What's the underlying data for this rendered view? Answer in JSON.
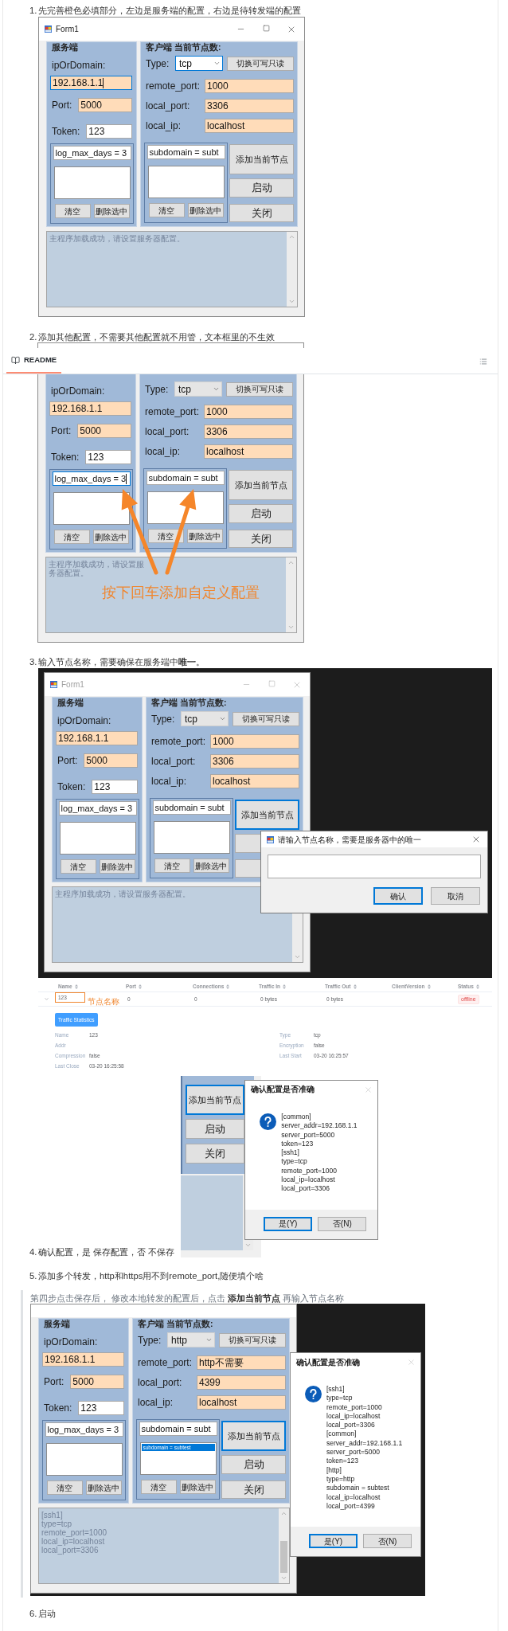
{
  "readme_tab": {
    "label": "README",
    "selected": true
  },
  "steps": [
    {
      "number": "1.",
      "text": "先完善橙色必填部分，左边是服务端的配置，右边是待转发端的配置",
      "figures": [
        {
          "kind": "form",
          "form": {
            "title_bar": {
              "title": "Form1",
              "active": true
            },
            "server": {
              "title": "服务端",
              "fields": [
                {
                  "kind": "stacked",
                  "label": "ipOrDomain:",
                  "value": "192.168.1.1",
                  "required": true,
                  "focused": true
                },
                {
                  "kind": "inline",
                  "label": "Port:",
                  "value": "5000",
                  "required": true,
                  "focused": false
                },
                {
                  "kind": "inline",
                  "label": "Token:",
                  "value": "123",
                  "required": false,
                  "focused": false
                }
              ],
              "param_input": {
                "value": "log_max_days = 3",
                "focused": false
              },
              "buttons": [
                "清空",
                "删除选中"
              ]
            },
            "client": {
              "title": "客户端 当前节点数:",
              "type": {
                "label": "Type:",
                "value": "tcp",
                "focused": true
              },
              "toggle_button": "切换可写只读",
              "fields": [
                {
                  "label": "remote_port:",
                  "value": "1000",
                  "required": true,
                  "focused": false
                },
                {
                  "label": "local_port:",
                  "value": "3306",
                  "required": true,
                  "focused": false
                },
                {
                  "label": "local_ip:",
                  "value": "localhost",
                  "required": true,
                  "focused": false
                }
              ],
              "param_input": {
                "value": "subdomain = subt",
                "focused": false
              },
              "buttons": [
                "清空",
                "删除选中"
              ]
            },
            "action_buttons": [
              {
                "label": "添加当前节点",
                "focused": false
              },
              {
                "label": "启动",
                "focused": false
              },
              {
                "label": "关闭",
                "focused": false
              }
            ],
            "log": {
              "lines": [
                "主程序加载成功，请设置服务器配置。"
              ],
              "scrollbar_thumb": false
            }
          }
        }
      ]
    },
    {
      "number": "2.",
      "text": "添加其他配置，不需要其他配置就不用管，文本框里的不生效",
      "figures": [
        {
          "kind": "annotated_form",
          "caption": "按下回车添加自定义配置",
          "form": {
            "server": {
              "fields": [
                {
                  "kind": "stacked",
                  "label": "ipOrDomain:",
                  "value": "192.168.1.1",
                  "required": true,
                  "focused": false
                },
                {
                  "kind": "inline",
                  "label": "Port:",
                  "value": "5000",
                  "required": true,
                  "focused": false
                },
                {
                  "kind": "inline",
                  "label": "Token:",
                  "value": "123",
                  "required": false,
                  "focused": false
                }
              ],
              "param_input": {
                "value": "log_max_days = 3",
                "focused": true
              },
              "buttons": [
                "清空",
                "删除选中"
              ]
            },
            "client": {
              "type": {
                "label": "Type:",
                "value": "tcp",
                "focused": false
              },
              "toggle_button": "切换可写只读",
              "fields": [
                {
                  "label": "remote_port:",
                  "value": "1000",
                  "required": true,
                  "focused": false
                },
                {
                  "label": "local_port:",
                  "value": "3306",
                  "required": true,
                  "focused": false
                },
                {
                  "label": "local_ip:",
                  "value": "localhost",
                  "required": true,
                  "focused": false
                }
              ],
              "param_input": {
                "value": "subdomain = subt",
                "focused": false
              },
              "buttons": [
                "清空",
                "删除选中"
              ]
            },
            "action_buttons": [
              {
                "label": "添加当前节点",
                "focused": false
              },
              {
                "label": "启动",
                "focused": false
              },
              {
                "label": "关闭",
                "focused": false
              }
            ],
            "log": {
              "lines": [
                "主程序加载成功，请设置服务器配置。"
              ],
              "scrollbar_thumb": false
            }
          }
        }
      ]
    },
    {
      "number": "3.",
      "text": "输入节点名称，需要确保在服务端中**唯一**。",
      "figures": [
        {
          "kind": "form_with_prompt",
          "form": {
            "title_bar": {
              "title": "Form1",
              "active": false
            },
            "server": {
              "title": "服务端",
              "fields": [
                {
                  "kind": "stacked",
                  "label": "ipOrDomain:",
                  "value": "192.168.1.1",
                  "required": true,
                  "focused": false
                },
                {
                  "kind": "inline",
                  "label": "Port:",
                  "value": "5000",
                  "required": true,
                  "focused": false
                },
                {
                  "kind": "inline",
                  "label": "Token:",
                  "value": "123",
                  "required": false,
                  "focused": false
                }
              ],
              "param_input": {
                "value": "log_max_days = 3",
                "focused": false
              },
              "buttons": [
                "清空",
                "删除选中"
              ]
            },
            "client": {
              "title": "客户端 当前节点数:",
              "type": {
                "label": "Type:",
                "value": "tcp",
                "focused": false
              },
              "toggle_button": "切换可写只读",
              "fields": [
                {
                  "label": "remote_port:",
                  "value": "1000",
                  "required": true,
                  "focused": false
                },
                {
                  "label": "local_port:",
                  "value": "3306",
                  "required": true,
                  "focused": false
                },
                {
                  "label": "local_ip:",
                  "value": "localhost",
                  "required": true,
                  "focused": false
                }
              ],
              "param_input": {
                "value": "subdomain = subt",
                "focused": false
              },
              "buttons": [
                "清空",
                "删除选中"
              ]
            },
            "action_buttons": [
              {
                "label": "添加当前节点",
                "focused": true
              },
              {
                "focused": false
              },
              {
                "focused": false
              }
            ],
            "log": {
              "lines": [
                "主程序加载成功，请设置服务器配置。"
              ],
              "scrollbar_thumb": false
            }
          },
          "prompt": {
            "title": "请输入节点名称，需要是服务器中的唯一",
            "buttons": [
              {
                "label": "确认",
                "default": true
              },
              {
                "label": "取消",
                "default": false
              }
            ]
          }
        },
        {
          "kind": "node_table",
          "columns": [
            "Name",
            "Port",
            "Connections",
            "Traffic In",
            "Traffic Out",
            "ClientVersion",
            "Status"
          ],
          "rows": [
            {
              "expanded": true,
              "name": "123",
              "highlighted": true,
              "note": "节点名称",
              "port": "0",
              "connections": "0",
              "traffic_in": "0 bytes",
              "traffic_out": "0 bytes",
              "status": "offline",
              "detail": {
                "button": "Traffic Statistics",
                "left": [
                  {
                    "label": "Name",
                    "value": "123"
                  },
                  {
                    "label": "Addr"
                  },
                  {
                    "label": "Compression",
                    "value": "false"
                  },
                  {
                    "label": "Last Close",
                    "value": "03-20 16:25:58"
                  }
                ],
                "right": [
                  {
                    "label": "Type",
                    "value": "tcp"
                  },
                  {
                    "label": "Encryption",
                    "value": "false"
                  },
                  {
                    "label": "Last Start",
                    "value": "03-20 16:25:57"
                  }
                ]
              }
            }
          ]
        }
      ]
    },
    {
      "number": "4.",
      "text": "确认配置，是 保存配置，否 不保存",
      "figures": [
        {
          "kind": "confirm_crop",
          "action_buttons": [
            {
              "label": "添加当前节点",
              "focused": true
            },
            {
              "label": "启动",
              "focused": false
            },
            {
              "label": "关闭",
              "focused": false
            }
          ],
          "dialog": {
            "title": "确认配置是否准确",
            "lines": [
              "[common]",
              "server_addr=192.168.1.1",
              "server_port=5000",
              "token=123",
              "[ssh1]",
              "type=tcp",
              "remote_port=1000",
              "local_ip=localhost",
              "local_port=3306"
            ],
            "buttons": [
              {
                "label": "是(Y)",
                "default": true
              },
              {
                "label": "否(N)",
                "default": false
              }
            ]
          }
        }
      ]
    },
    {
      "number": "5.",
      "text": "添加多个转发，http和https用不到remote_port,随便填个啥",
      "quote": {
        "text": "第四步点击保存后， 修改本地转发的配置后，点击 **添加当前节点** 再输入节点名称",
        "figures": [
          {
            "kind": "form_with_confirm",
            "form": {
              "server": {
                "title": "服务端",
                "fields": [
                  {
                    "kind": "stacked",
                    "label": "ipOrDomain:",
                    "value": "192.168.1.1",
                    "required": true,
                    "focused": false
                  },
                  {
                    "kind": "inline",
                    "label": "Port:",
                    "value": "5000",
                    "required": true,
                    "focused": false
                  },
                  {
                    "kind": "inline",
                    "label": "Token:",
                    "value": "123",
                    "required": false,
                    "focused": false
                  }
                ],
                "param_input": {
                  "value": "log_max_days = 3",
                  "focused": false
                },
                "buttons": [
                  "清空",
                  "删除选中"
                ]
              },
              "client": {
                "title": "客户端 当前节点数:",
                "type": {
                  "label": "Type:",
                  "value": "http",
                  "focused": false
                },
                "toggle_button": "切换可写只读",
                "fields": [
                  {
                    "label": "remote_port:",
                    "value": "http不需要",
                    "required": true,
                    "focused": false
                  },
                  {
                    "label": "local_port:",
                    "value": "4399",
                    "required": true,
                    "focused": false
                  },
                  {
                    "label": "local_ip:",
                    "value": "localhost",
                    "required": true,
                    "focused": false
                  }
                ],
                "param_input": {
                  "value": "subdomain = subt",
                  "focused": false
                },
                "list_items": [
                  {
                    "text": "subdomain = subtest",
                    "selected": true
                  }
                ],
                "buttons": [
                  "清空",
                  "删除选中"
                ]
              },
              "action_buttons": [
                {
                  "label": "添加当前节点",
                  "focused": true
                },
                {
                  "label": "启动",
                  "focused": false
                },
                {
                  "label": "关闭",
                  "focused": false
                }
              ],
              "log": {
                "lines": [
                  "[ssh1]",
                  "type=tcp",
                  "remote_port=1000",
                  "local_ip=localhost",
                  "local_port=3306"
                ],
                "scrollbar_thumb": true
              }
            },
            "dialog": {
              "title": "确认配置是否准确",
              "lines": [
                "[ssh1]",
                "type=tcp",
                "remote_port=1000",
                "local_ip=localhost",
                "local_port=3306",
                "[common]",
                "server_addr=192.168.1.1",
                "server_port=5000",
                "token=123",
                "[http]",
                "type=http",
                "subdomain = subtest",
                "local_ip=localhost",
                "local_port=4399"
              ],
              "buttons": [
                {
                  "label": "是(Y)",
                  "default": true
                },
                {
                  "label": "否(N)",
                  "default": false
                }
              ]
            }
          }
        ]
      }
    },
    {
      "number": "6.",
      "text": "启动"
    }
  ]
}
